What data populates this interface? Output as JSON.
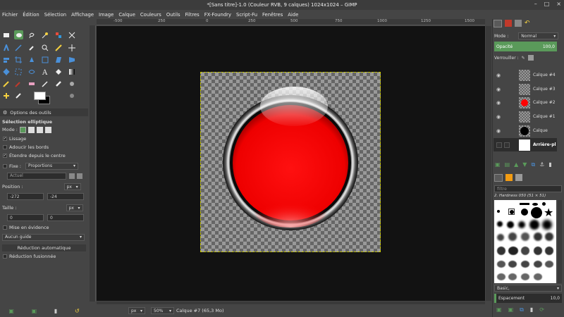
{
  "window": {
    "title": "*[Sans titre]-1.0 (Couleur RVB, 9 calques) 1024x1024 – GIMP",
    "controls": [
      "–",
      "□",
      "×"
    ]
  },
  "menu": [
    "Fichier",
    "Édition",
    "Sélection",
    "Affichage",
    "Image",
    "Calque",
    "Couleurs",
    "Outils",
    "Filtres",
    "FX-Foundry",
    "Script-Fu",
    "Fenêtres",
    "Aide"
  ],
  "tool_options": {
    "tab": "Options des outils",
    "title": "Sélection elliptique",
    "mode_label": "Mode :",
    "antialias": "Lissage",
    "feather": "Adoucir les bords",
    "expand": "Étendre depuis le centre",
    "fixed_label": "Fixe :",
    "fixed_value": "Proportions",
    "current": "Actuel",
    "position_label": "Position :",
    "position_unit": "px",
    "pos_x": "-272",
    "pos_y": "-24",
    "size_label": "Taille :",
    "size_unit": "px",
    "size_w": "0",
    "size_h": "0",
    "highlight": "Mise en évidence",
    "guides": "Aucun guide",
    "auto_shrink": "Réduction automatique",
    "shrink_merged": "Réduction fusionnée"
  },
  "ruler_ticks": [
    "-500",
    "250",
    "0",
    "250",
    "500",
    "750",
    "1000",
    "1250",
    "1500"
  ],
  "statusbar": {
    "unit": "px",
    "zoom": "50%",
    "info": "Calque #7 (65,3 Mo)"
  },
  "layers_panel": {
    "mode_label": "Mode :",
    "mode_value": "Normal",
    "opacity_label": "Opacité",
    "opacity_value": "100,0",
    "lock_label": "Verrouiller :",
    "layers": [
      {
        "name": "Calque #4",
        "thumb": "checker"
      },
      {
        "name": "Calque #3",
        "thumb": "checker"
      },
      {
        "name": "Calque #2",
        "thumb": "red"
      },
      {
        "name": "Calque #1",
        "thumb": "checker"
      },
      {
        "name": "Calque",
        "thumb": "black"
      },
      {
        "name": "Arrière-pl",
        "thumb": "white"
      }
    ]
  },
  "brushes_panel": {
    "filter": "filtre",
    "brush_name": "2. Hardness 050 (51 × 51)",
    "preset": "Basic,",
    "spacing_label": "Espacement",
    "spacing_value": "10,0"
  },
  "colors": {
    "accent": "#5a9a5a",
    "button_red": "#ff0000"
  }
}
